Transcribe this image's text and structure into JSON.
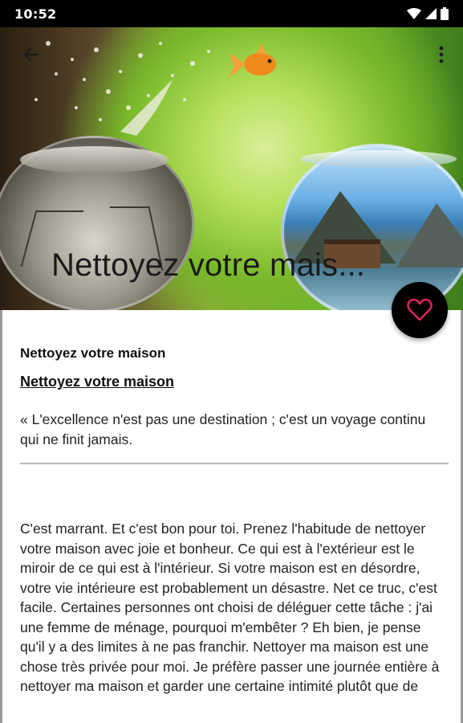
{
  "status_bar": {
    "time": "10:52",
    "icons": [
      "wifi-icon",
      "signal-icon",
      "battery-icon"
    ]
  },
  "toolbar": {
    "back_icon": "arrow-back-icon",
    "menu_icon": "more-vert-icon",
    "title": "Nettoyez votre mais..."
  },
  "fab": {
    "icon": "heart-outline-icon",
    "accent": "#e0245e"
  },
  "article": {
    "heading": "Nettoyez votre maison",
    "subheading": "Nettoyez votre maison ",
    "quote": "« L'excellence n'est pas une destination ; c'est un voyage continu qui ne finit jamais.",
    "body": "C'est marrant. Et c'est bon pour toi. Prenez l'habitude de nettoyer votre maison avec joie et bonheur. Ce qui est à l'extérieur est le miroir de ce qui est à l'intérieur. Si votre maison est en désordre, votre vie intérieure est probablement un désastre. Net ce truc, c'est facile. Certaines personnes ont choisi de déléguer cette tâche : j'ai une femme de ménage, pourquoi m'embêter ? Eh bien, je pense qu'il y a des limites à ne pas franchir. Nettoyer ma maison est une chose très privée pour moi. Je préfère passer une journée entière à nettoyer ma maison et garder une certaine intimité plutôt que de"
  }
}
